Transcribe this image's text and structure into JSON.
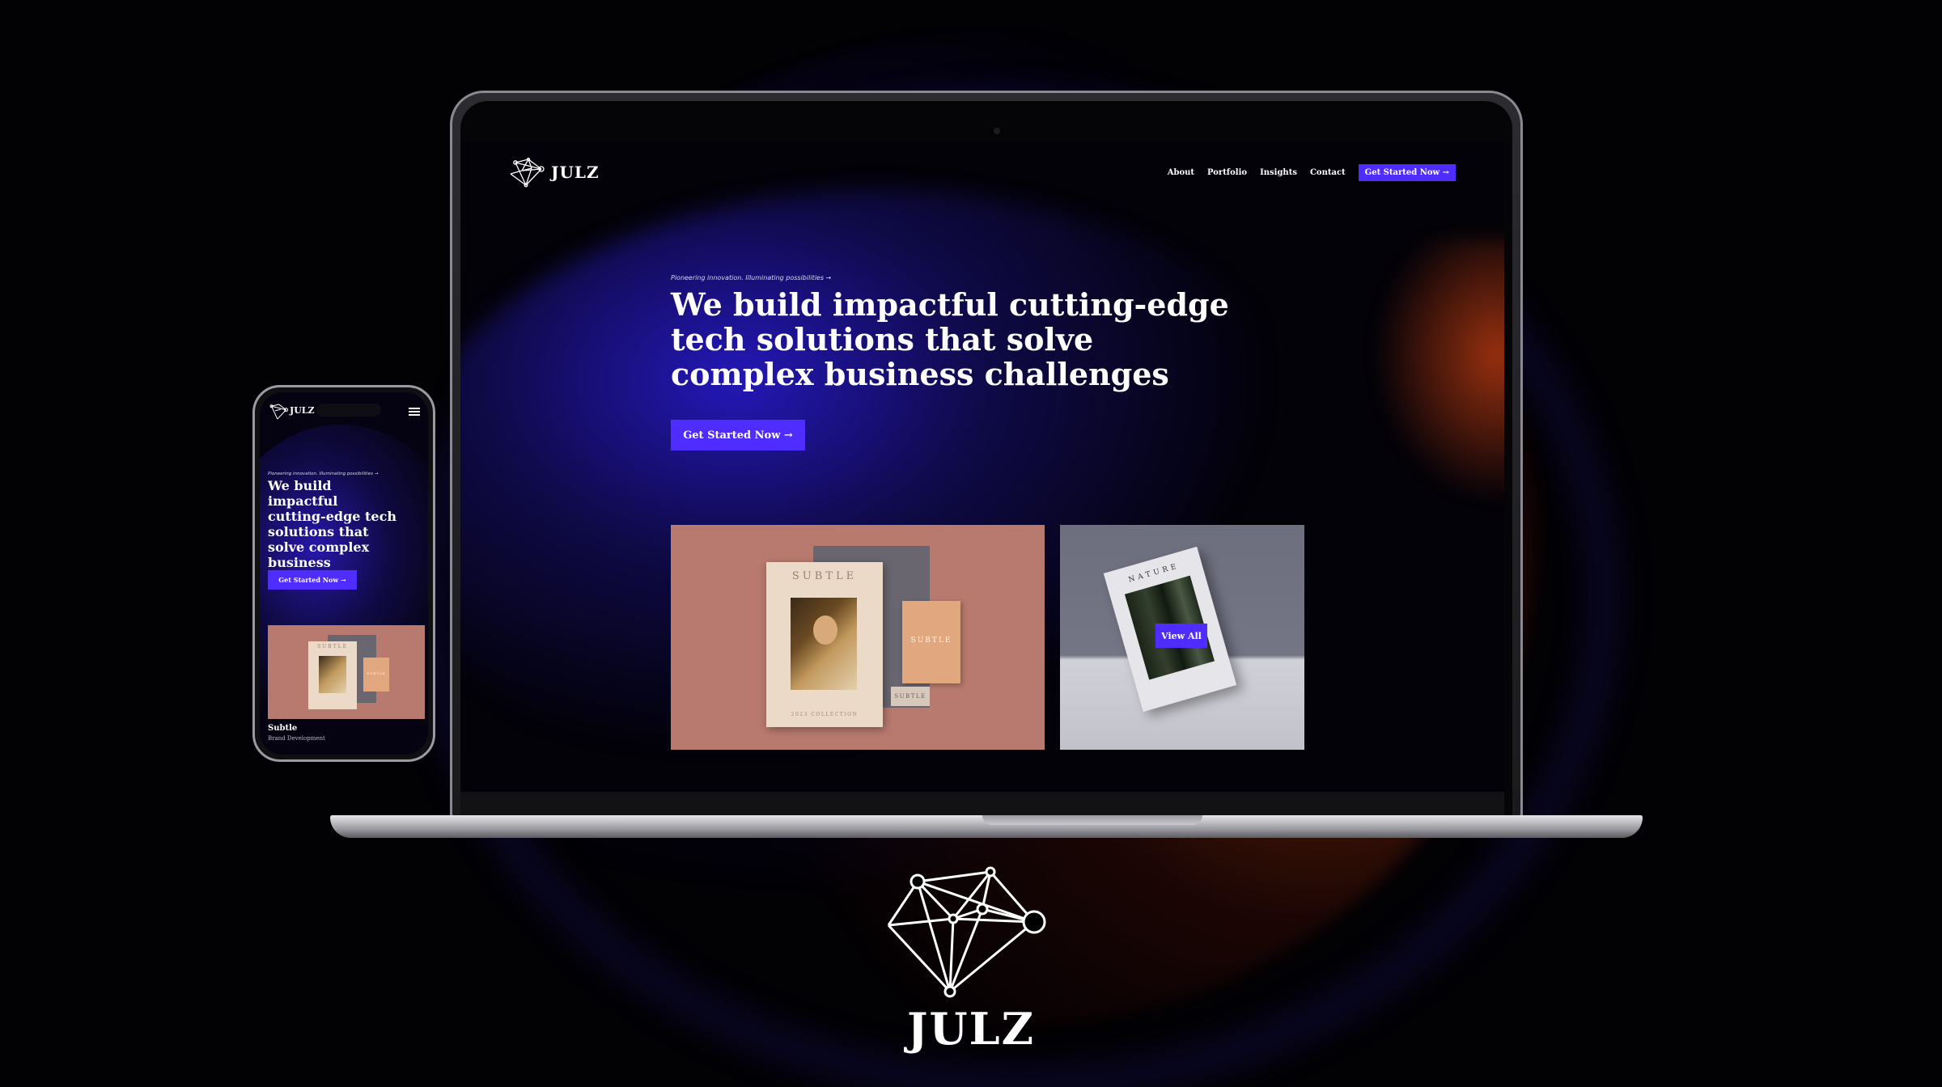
{
  "brand": {
    "name": "JULZ",
    "accent_color": "#4f2cff",
    "logo_icon": "network-diamond-icon"
  },
  "laptop_site": {
    "nav": {
      "logo_text": "JULZ",
      "links": [
        "About",
        "Portfolio",
        "Insights",
        "Contact"
      ],
      "cta": "Get Started Now →"
    },
    "hero": {
      "tagline": "Pioneering innovation. Illuminating possibilities →",
      "title": "We build impactful cutting-edge tech solutions that solve complex business challenges",
      "cta": "Get Started Now →"
    },
    "portfolio": {
      "card1": {
        "book_title": "SUBTLE",
        "book_footer": "2023 COLLECTION",
        "small_book_title": "SUBTLE",
        "strip_title": "SUBTLE"
      },
      "card2": {
        "book_title": "NATURE",
        "button": "View All"
      }
    }
  },
  "phone_site": {
    "logo_text": "JULZ",
    "menu_icon": "hamburger-menu-icon",
    "hero": {
      "tagline": "Pioneering innovation. Illuminating possibilities →",
      "title": "We build impactful cutting-edge tech solutions that solve complex business challenges",
      "cta": "Get Started Now →"
    },
    "card": {
      "title": "Subtle",
      "subtitle": "Brand Development",
      "book_title": "SUBTLE",
      "small_book_title": "SUBTLE"
    }
  }
}
